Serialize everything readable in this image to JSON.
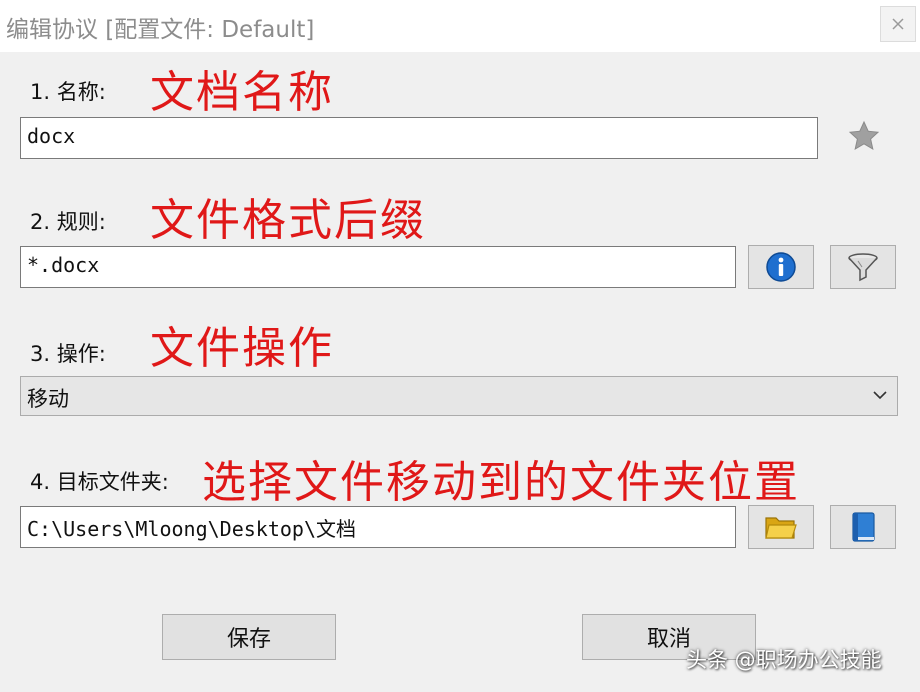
{
  "window": {
    "title": "编辑协议 [配置文件: Default]"
  },
  "fields": {
    "name": {
      "label": "1. 名称:",
      "annotation": "文档名称",
      "value": "docx"
    },
    "rule": {
      "label": "2. 规则:",
      "annotation": "文件格式后缀",
      "value": "*.docx"
    },
    "action": {
      "label": "3. 操作:",
      "annotation": "文件操作",
      "selected": "移动"
    },
    "target": {
      "label": "4. 目标文件夹:",
      "annotation": "选择文件移动到的文件夹位置",
      "value": "C:\\Users\\Mloong\\Desktop\\文档"
    }
  },
  "buttons": {
    "save": "保存",
    "cancel": "取消"
  },
  "icons": {
    "close": "close-icon",
    "favorite": "star-icon",
    "info": "info-icon",
    "filter": "filter-icon",
    "folder": "folder-open-icon",
    "book": "book-icon",
    "dropdown": "chevron-down-icon"
  },
  "watermark": "头条 @职场办公技能",
  "colors": {
    "annotation": "#e01818",
    "window_bg": "#f0f0f0",
    "title_text": "#8c8c8c"
  }
}
